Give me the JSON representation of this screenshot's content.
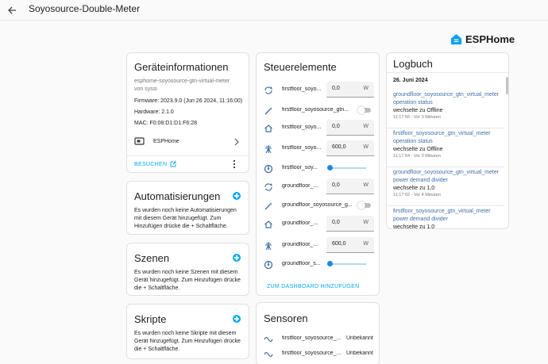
{
  "header": {
    "title": "Soyosource-Double-Meter"
  },
  "brand": {
    "name": "ESPHome",
    "color": "#0aa1e6"
  },
  "device_info": {
    "title": "Geräteinformationen",
    "device_name": "esphome-soyosource-gtn-virtual-meter",
    "by": "von syssi",
    "firmware": "Firmware: 2023.9.0 (Jun 26 2024, 11:16:00)",
    "hardware": "Hardware: 2.1.0",
    "mac": "MAC: F0:08:D1:D1:F6:28",
    "integration": "ESPHome",
    "visit": "BESUCHEN"
  },
  "automations": {
    "title": "Automatisierungen",
    "text": "Es wurden noch keine Automatisierungen mit diesem Gerät hinzugefügt. Zum Hinzufügen drücke die + Schaltfläche."
  },
  "scenes": {
    "title": "Szenen",
    "text": "Es wurden noch keine Szenen mit diesem Gerät hinzugefügt. Zum Hinzufügen drücke die + Schaltfläche."
  },
  "scripts": {
    "title": "Skripte",
    "text": "Es wurden noch keine Skripte mit diesem Gerät hinzugefügt. Zum Hinzufügen drücke die + Schaltfläche."
  },
  "controls": {
    "title": "Steuerelemente",
    "rows": [
      {
        "icon": "refresh-icon",
        "label": "firstfloor_soyo...",
        "type": "number",
        "value": "0,0",
        "unit": "W"
      },
      {
        "icon": "wand-icon",
        "label": "firstfloor_soyosource_gtn...",
        "type": "toggle"
      },
      {
        "icon": "home-icon",
        "label": "firstfloor_soyo...",
        "type": "number",
        "value": "0,0",
        "unit": "W"
      },
      {
        "icon": "tower-icon",
        "label": "firstfloor_soyo...",
        "type": "number",
        "value": "600,0",
        "unit": "W"
      },
      {
        "icon": "gauge-icon",
        "label": "firstfloor_soy...",
        "type": "slider",
        "level": 0
      },
      {
        "icon": "refresh-icon",
        "label": "groundfloor_...",
        "type": "number",
        "value": "0,0",
        "unit": "W"
      },
      {
        "icon": "wand-icon",
        "label": "groundfloor_soyosource_g...",
        "type": "toggle"
      },
      {
        "icon": "home-icon",
        "label": "groundfloor_...",
        "type": "number",
        "value": "0,0",
        "unit": "W"
      },
      {
        "icon": "tower-icon",
        "label": "groundfloor_...",
        "type": "number",
        "value": "600,0",
        "unit": "W"
      },
      {
        "icon": "gauge-icon",
        "label": "groundfloor_s...",
        "type": "slider",
        "level": 0
      }
    ],
    "add_to_dashboard": "ZUM DASHBOARD HINZUFÜGEN"
  },
  "sensors": {
    "title": "Sensoren",
    "rows": [
      {
        "icon": "sine-icon",
        "label": "firstfloor_soyosource_...",
        "value": "Unbekannt"
      },
      {
        "icon": "sine-icon",
        "label": "firstfloor_soyosource_...",
        "value": "Unbekannt"
      }
    ]
  },
  "logbook": {
    "title": "Logbuch",
    "date": "26. Juni 2024",
    "entries": [
      {
        "entity": "groundfloor_soyosource_gtn_virtual_meter operation status",
        "change": "wechselte zu Offline",
        "time": "11:17:56 - Vor 3 Minuten"
      },
      {
        "entity": "firstfloor_soyosource_gtn_virtual_meter operation status",
        "change": "wechselte zu Offline",
        "time": "11:17:54 - Vor 3 Minuten"
      },
      {
        "entity": "groundfloor_soyosource_gtn_virtual_meter power demand divider",
        "change": "wechselte zu 1,0",
        "time": "11:17:02 - Vor 4 Minuten"
      },
      {
        "entity": "firstfloor_soyosource_gtn_virtual_meter power demand divider",
        "change": "wechselte zu 1,0",
        "time": ""
      }
    ]
  }
}
